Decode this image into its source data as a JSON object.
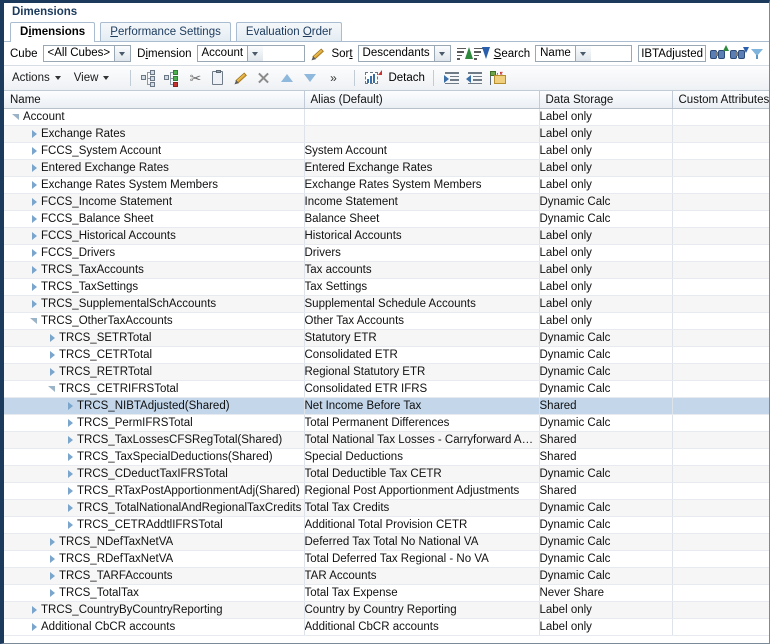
{
  "panel": {
    "title": "Dimensions"
  },
  "tabs": [
    {
      "label": "Dimensions",
      "mnemonic_index": 1,
      "active": true
    },
    {
      "label": "Performance Settings",
      "mnemonic_index": 0,
      "active": false
    },
    {
      "label": "Evaluation Order",
      "mnemonic_index": 11,
      "active": false
    }
  ],
  "filterbar": {
    "cube_label": "Cube",
    "cube_value": "<All Cubes>",
    "dimension_label": "Dimension",
    "dimension_value": "Account",
    "edit_icon": "pencil-icon",
    "sort_label": "Sort",
    "sort_mnemonic_index": 3,
    "sort_value": "Descendants",
    "sort_asc_icon": "sort-ascending-icon",
    "sort_desc_icon": "sort-descending-icon",
    "search_label": "Search",
    "search_mnemonic_index": 0,
    "search_by_value": "Name",
    "search_text": "TRCS_NIBTAdjusted",
    "find_up_icon": "binoculars-up-icon",
    "find_down_icon": "binoculars-down-icon",
    "filter_icon": "funnel-icon"
  },
  "toolbar": {
    "actions_label": "Actions",
    "view_label": "View",
    "add_sibling_icon": "add-sibling-icon",
    "add_child_icon": "add-child-icon",
    "cut_icon": "scissors-icon",
    "paste_icon": "clipboard-icon",
    "edit_icon": "pencil-icon",
    "delete_icon": "delete-x-icon",
    "move_up_icon": "move-up-icon",
    "move_down_icon": "move-down-icon",
    "overflow_icon": "chevron-double-right-icon",
    "detach_icon": "detach-icon",
    "detach_label": "Detach",
    "indent_icon": "indent-icon",
    "outdent_icon": "outdent-icon",
    "move_to_icon": "move-to-icon"
  },
  "table": {
    "columns": [
      "Name",
      "Alias (Default)",
      "Data Storage",
      "Custom Attributes"
    ],
    "rows": [
      {
        "name": "Account",
        "indent": 0,
        "toggle": "open",
        "alias": "",
        "storage": "Label only",
        "custom": "",
        "selected": false
      },
      {
        "name": "Exchange Rates",
        "indent": 1,
        "toggle": "closed",
        "alias": "",
        "storage": "Label only",
        "custom": "",
        "selected": false
      },
      {
        "name": "FCCS_System Account",
        "indent": 1,
        "toggle": "closed",
        "alias": "System Account",
        "storage": "Label only",
        "custom": "",
        "selected": false
      },
      {
        "name": "Entered Exchange Rates",
        "indent": 1,
        "toggle": "closed",
        "alias": "Entered Exchange Rates",
        "storage": "Label only",
        "custom": "",
        "selected": false
      },
      {
        "name": "Exchange Rates System Members",
        "indent": 1,
        "toggle": "closed",
        "alias": "Exchange Rates System Members",
        "storage": "Label only",
        "custom": "",
        "selected": false
      },
      {
        "name": "FCCS_Income Statement",
        "indent": 1,
        "toggle": "closed",
        "alias": "Income Statement",
        "storage": "Dynamic Calc",
        "custom": "",
        "selected": false
      },
      {
        "name": "FCCS_Balance Sheet",
        "indent": 1,
        "toggle": "closed",
        "alias": "Balance Sheet",
        "storage": "Dynamic Calc",
        "custom": "",
        "selected": false
      },
      {
        "name": "FCCS_Historical Accounts",
        "indent": 1,
        "toggle": "closed",
        "alias": "Historical Accounts",
        "storage": "Label only",
        "custom": "",
        "selected": false
      },
      {
        "name": "FCCS_Drivers",
        "indent": 1,
        "toggle": "closed",
        "alias": "Drivers",
        "storage": "Label only",
        "custom": "",
        "selected": false
      },
      {
        "name": "TRCS_TaxAccounts",
        "indent": 1,
        "toggle": "closed",
        "alias": "Tax accounts",
        "storage": "Label only",
        "custom": "",
        "selected": false
      },
      {
        "name": "TRCS_TaxSettings",
        "indent": 1,
        "toggle": "closed",
        "alias": "Tax Settings",
        "storage": "Label only",
        "custom": "",
        "selected": false
      },
      {
        "name": "TRCS_SupplementalSchAccounts",
        "indent": 1,
        "toggle": "closed",
        "alias": "Supplemental Schedule Accounts",
        "storage": "Label only",
        "custom": "",
        "selected": false
      },
      {
        "name": "TRCS_OtherTaxAccounts",
        "indent": 1,
        "toggle": "open",
        "alias": "Other Tax Accounts",
        "storage": "Label only",
        "custom": "",
        "selected": false
      },
      {
        "name": "TRCS_SETRTotal",
        "indent": 2,
        "toggle": "closed",
        "alias": "Statutory ETR",
        "storage": "Dynamic Calc",
        "custom": "",
        "selected": false
      },
      {
        "name": "TRCS_CETRTotal",
        "indent": 2,
        "toggle": "closed",
        "alias": "Consolidated ETR",
        "storage": "Dynamic Calc",
        "custom": "",
        "selected": false
      },
      {
        "name": "TRCS_RETRTotal",
        "indent": 2,
        "toggle": "closed",
        "alias": "Regional Statutory ETR",
        "storage": "Dynamic Calc",
        "custom": "",
        "selected": false
      },
      {
        "name": "TRCS_CETRIFRSTotal",
        "indent": 2,
        "toggle": "open",
        "alias": "Consolidated ETR IFRS",
        "storage": "Dynamic Calc",
        "custom": "",
        "selected": false
      },
      {
        "name": "TRCS_NIBTAdjusted(Shared)",
        "indent": 3,
        "toggle": "closed",
        "alias": "Net Income Before Tax",
        "storage": "Shared",
        "custom": "",
        "selected": true
      },
      {
        "name": "TRCS_PermIFRSTotal",
        "indent": 3,
        "toggle": "closed",
        "alias": "Total Permanent Differences",
        "storage": "Dynamic Calc",
        "custom": "",
        "selected": false
      },
      {
        "name": "TRCS_TaxLossesCFSRegTotal(Shared)",
        "indent": 3,
        "toggle": "closed",
        "alias": "Total National Tax Losses - Carryforward Auto...",
        "storage": "Shared",
        "custom": "",
        "selected": false
      },
      {
        "name": "TRCS_TaxSpecialDeductions(Shared)",
        "indent": 3,
        "toggle": "closed",
        "alias": "Special Deductions",
        "storage": "Shared",
        "custom": "",
        "selected": false
      },
      {
        "name": "TRCS_CDeductTaxIFRSTotal",
        "indent": 3,
        "toggle": "closed",
        "alias": "Total Deductible Tax CETR",
        "storage": "Dynamic Calc",
        "custom": "",
        "selected": false
      },
      {
        "name": "TRCS_RTaxPostApportionmentAdj(Shared)",
        "indent": 3,
        "toggle": "closed",
        "alias": "Regional Post Apportionment Adjustments",
        "storage": "Shared",
        "custom": "",
        "selected": false
      },
      {
        "name": "TRCS_TotalNationalAndRegionalTaxCredits",
        "indent": 3,
        "toggle": "closed",
        "alias": "Total Tax Credits",
        "storage": "Dynamic Calc",
        "custom": "",
        "selected": false
      },
      {
        "name": "TRCS_CETRAddtlIFRSTotal",
        "indent": 3,
        "toggle": "closed",
        "alias": "Additional Total Provision CETR",
        "storage": "Dynamic Calc",
        "custom": "",
        "selected": false
      },
      {
        "name": "TRCS_NDefTaxNetVA",
        "indent": 2,
        "toggle": "closed",
        "alias": "Deferred Tax Total No National VA",
        "storage": "Dynamic Calc",
        "custom": "",
        "selected": false
      },
      {
        "name": "TRCS_RDefTaxNetVA",
        "indent": 2,
        "toggle": "closed",
        "alias": "Total Deferred Tax Regional - No VA",
        "storage": "Dynamic Calc",
        "custom": "",
        "selected": false
      },
      {
        "name": "TRCS_TARFAccounts",
        "indent": 2,
        "toggle": "closed",
        "alias": "TAR Accounts",
        "storage": "Dynamic Calc",
        "custom": "",
        "selected": false
      },
      {
        "name": "TRCS_TotalTax",
        "indent": 2,
        "toggle": "closed",
        "alias": "Total Tax Expense",
        "storage": "Never Share",
        "custom": "",
        "selected": false
      },
      {
        "name": "TRCS_CountryByCountryReporting",
        "indent": 1,
        "toggle": "closed",
        "alias": "Country by Country Reporting",
        "storage": "Label only",
        "custom": "",
        "selected": false
      },
      {
        "name": "Additional CbCR accounts",
        "indent": 1,
        "toggle": "closed",
        "alias": "Additional CbCR accounts",
        "storage": "Label only",
        "custom": "",
        "selected": false
      }
    ]
  },
  "colors": {
    "accent": "#1b3a5c",
    "selection": "#c3d6ea",
    "header_border": "#b6c1cc"
  }
}
